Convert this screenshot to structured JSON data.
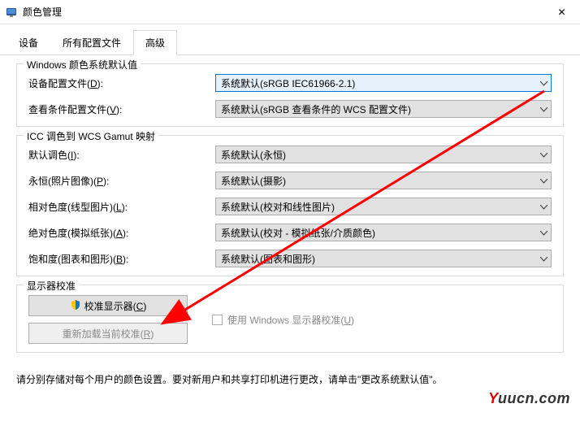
{
  "window": {
    "title": "颜色管理",
    "close": "✕"
  },
  "tabs": {
    "devices": "设备",
    "all_profiles": "所有配置文件",
    "advanced": "高级"
  },
  "group_defaults": {
    "legend": "Windows 颜色系统默认值",
    "device_profile_label": "设备配置文件(",
    "device_profile_key": "D",
    "device_profile_suffix": "):",
    "device_profile_value": "系统默认(sRGB IEC61966-2.1)",
    "viewing_profile_label": "查看条件配置文件(",
    "viewing_profile_key": "V",
    "viewing_profile_suffix": "):",
    "viewing_profile_value": "系统默认(sRGB 查看条件的 WCS 配置文件)"
  },
  "group_gamut": {
    "legend": "ICC 调色到 WCS Gamut 映射",
    "default_intent_label": "默认调色(",
    "default_intent_key": "I",
    "default_intent_suffix": "):",
    "default_intent_value": "系统默认(永恒)",
    "perceptual_label": "永恒(照片图像)(",
    "perceptual_key": "P",
    "perceptual_suffix": "):",
    "perceptual_value": "系统默认(摄影)",
    "relative_label": "相对色度(线型图片)(",
    "relative_key": "L",
    "relative_suffix": "):",
    "relative_value": "系统默认(校对和线性图片)",
    "absolute_label": "绝对色度(模拟纸张)(",
    "absolute_key": "A",
    "absolute_suffix": "):",
    "absolute_value": "系统默认(校对 - 模拟纸张/介质颜色)",
    "saturation_label": "饱和度(图表和图形)(",
    "saturation_key": "B",
    "saturation_suffix": "):",
    "saturation_value": "系统默认(图表和图形)"
  },
  "group_calib": {
    "legend": "显示器校准",
    "calibrate_btn": "校准显示器(",
    "calibrate_key": "C",
    "calibrate_suffix": ")",
    "reload_btn": "重新加载当前校准(",
    "reload_key": "R",
    "reload_suffix": ")",
    "use_windows_label": "使用 Windows 显示器校准(",
    "use_windows_key": "U",
    "use_windows_suffix": ")"
  },
  "footer": "请分别存储对每个用户的颜色设置。要对新用户和共享打印机进行更改，请单击\"更改系统默认值\"。",
  "watermark": {
    "y": "Y",
    "rest": "uucn.com"
  }
}
